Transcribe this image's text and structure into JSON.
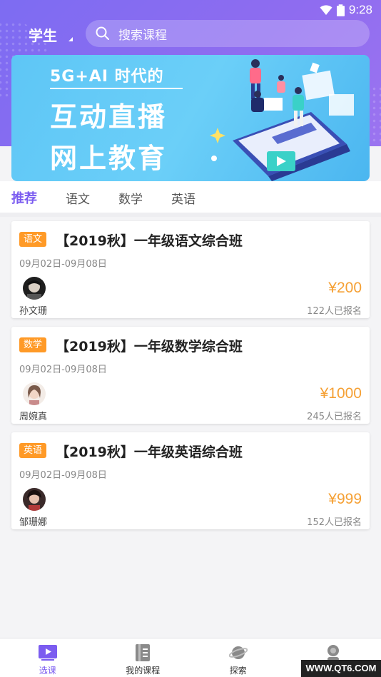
{
  "status_bar": {
    "time": "9:28"
  },
  "header": {
    "role": "学生",
    "search_placeholder": "搜索课程"
  },
  "banner": {
    "line1": "5G+AI 时代的",
    "line2": "互动直播",
    "line3": "网上教育"
  },
  "tabs": [
    {
      "label": "推荐",
      "active": true
    },
    {
      "label": "语文",
      "active": false
    },
    {
      "label": "数学",
      "active": false
    },
    {
      "label": "英语",
      "active": false
    }
  ],
  "courses": [
    {
      "subject": "语文",
      "title": "【2019秋】一年级语文综合班",
      "date": "09月02日-09月08日",
      "teacher": "孙文珊",
      "price": "¥200",
      "enrolled": "122人已报名"
    },
    {
      "subject": "数学",
      "title": "【2019秋】一年级数学综合班",
      "date": "09月02日-09月08日",
      "teacher": "周婉真",
      "price": "¥1000",
      "enrolled": "245人已报名"
    },
    {
      "subject": "英语",
      "title": "【2019秋】一年级英语综合班",
      "date": "09月02日-09月08日",
      "teacher": "邹珊娜",
      "price": "¥999",
      "enrolled": "152人已报名"
    }
  ],
  "bottom_nav": [
    {
      "label": "选课",
      "icon": "play-icon",
      "active": true
    },
    {
      "label": "我的课程",
      "icon": "book-icon",
      "active": false
    },
    {
      "label": "探索",
      "icon": "planet-icon",
      "active": false
    },
    {
      "label": "",
      "icon": "profile-icon",
      "active": false
    }
  ],
  "watermark": "WWW.QT6.COM",
  "colors": {
    "primary": "#7b5cf0",
    "price": "#f5a034",
    "tag": "#ff9a27"
  }
}
